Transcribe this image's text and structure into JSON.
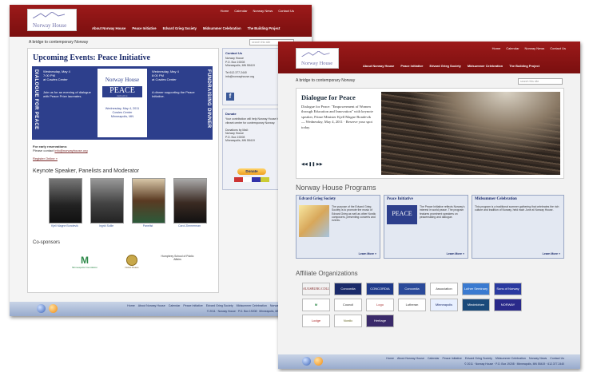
{
  "colors": {
    "header": "#8b1515",
    "flyer": "#2d3f8c",
    "footer": "#a8b8d6",
    "accent_link": "#7a2a2a",
    "heading": "#1a2a6a"
  },
  "site": {
    "logo_text": "Norway House",
    "top_links": [
      "Home",
      "Calendar",
      "Norway News",
      "Contact Us"
    ],
    "nav": [
      "About Norway House",
      "Peace Initiative",
      "Edvard Grieg Society",
      "Midsummer Celebration",
      "The Building Project"
    ],
    "breadcrumb": "A bridge to contemporary Norway",
    "search_placeholder": "search this site"
  },
  "back_page": {
    "title": "Upcoming Events: Peace Initiative",
    "flyer": {
      "left_vertical": "DIALOGUE FOR PEACE",
      "right_vertical": "FUNDRAISING DINNER",
      "left_date": "Wednesday, May 4\n7:00 PM\nat Cowles Center",
      "left_body": "Join us for an evening of dialogue with Peace Prize laureates.",
      "center_logo": "Norway House",
      "center_peace": "PEACE",
      "center_sub": "INITIATIVE",
      "center_event": "Wednesday, May 4, 2011\nCowles Center\nMinneapolis, MN",
      "right_date": "Wednesday, May 4\n8:00 PM\nat Cowles Center",
      "right_body": "A dinner supporting the Peace Initiative."
    },
    "reservations_label": "For early reservations:",
    "reservations_text": "Please contact",
    "reservations_link": "info@norwayhouse.org",
    "register_link": "Register Online »",
    "keynote_heading": "Keynote Speaker, Panelists and Moderator",
    "speakers": [
      {
        "caption": "Kjell Magne Bondevik"
      },
      {
        "caption": "Ingrid Sollie"
      },
      {
        "caption": "Panelist"
      },
      {
        "caption": "Carol Zimmerman"
      }
    ],
    "cosponsors_heading": "Co-sponsors",
    "cosponsors": [
      "Minneapolis Foundation",
      "Nobel Peace",
      "Humphrey School of Public Affairs"
    ],
    "sidebar": {
      "contact_title": "Contact Us",
      "contact_body": "Norway House\nP.O. Box 19208\nMinneapolis, MN 55419\n\nTel 612.377.2440\ninfo@norwayhouse.org",
      "donate_title": "Donate",
      "donate_body": "Your contribution will help Norway House build a vibrant center for contemporary Norway.\n\nDonations by Mail:\nNorway House\nP.O. Box 19208\nMinneapolis, MN 55419",
      "donate_button": "Donate"
    },
    "footer_links": [
      "Home",
      "About Norway House",
      "Calendar",
      "Peace Initiative",
      "Edvard Grieg Society",
      "Midsummer Celebration",
      "Norway News"
    ],
    "footer_copy": "© 2011 · Norway House · P.O. Box 19208 · Minneapolis, MN 55419"
  },
  "front_page": {
    "slide_title": "Dialogue for Peace",
    "slide_body": "Dialogue for Peace: \"Empowerment of Women through Education and Innovation\" with keynote speaker, Prime Minister Kjell Magne Bondevik — Wednesday, May 4, 2011 · Reserve your spot today.",
    "slide_controls": "◀◀ ❚❚ ▶▶",
    "programs_heading": "Norway House Programs",
    "programs": [
      {
        "title": "Edvard Grieg Society",
        "body": "The purpose of the Edvard Grieg Society is to promote the music of Edvard Grieg as well as other Nordic composers, presenting concerts and events.",
        "link": "Learn More »"
      },
      {
        "title": "Peace Initiative",
        "body": "The Peace Initiative reflects Norway's interest in world peace. The program features prominent speakers on peacemaking and dialogue.",
        "link": "Learn More »"
      },
      {
        "title": "Midsummer Celebration",
        "body": "This program is a traditional summer gathering that celebrates the rich culture and tradition of Norway, held each June at Norway House.",
        "link": "Learn More »"
      }
    ],
    "affiliates_heading": "Affiliate Organizations",
    "affiliates": [
      "AUGSBURG COLLEGE",
      "Concordia",
      "CONCORDIA",
      "Concordia",
      "Association",
      "Luther Seminary",
      "Sons of Norway",
      "M",
      "Council",
      "Logo",
      "Lutheran",
      "Minneapolis",
      "Mindekirken",
      "NORWAY",
      "Lodge",
      "Nordic",
      "Heritage"
    ],
    "footer_links": [
      "Home",
      "About Norway House",
      "Calendar",
      "Peace Initiative",
      "Edvard Grieg Society",
      "Midsummer Celebration",
      "Norway News",
      "Contact Us"
    ],
    "footer_copy": "© 2011 · Norway House · P.O. Box 19208 · Minneapolis, MN 55419 · 612.377.2440"
  }
}
